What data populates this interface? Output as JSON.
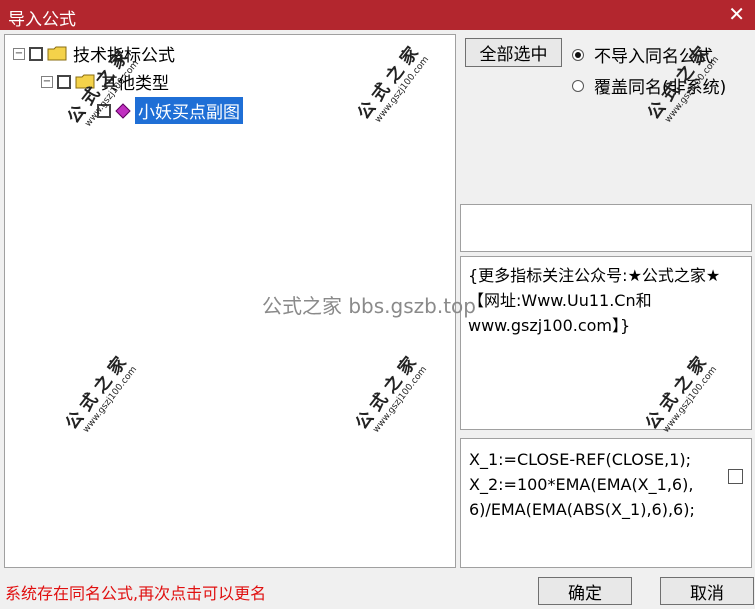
{
  "window": {
    "title": "导入公式",
    "close_glyph": "✕",
    "accent": "#b3262e"
  },
  "tree": {
    "root": {
      "toggle": "−",
      "label": "技术指标公式"
    },
    "group": {
      "toggle": "−",
      "label": "其他类型"
    },
    "item": {
      "label": "小妖买点副图",
      "selected": true
    }
  },
  "buttons": {
    "select_all": "全部选中",
    "ok": "确定",
    "cancel": "取消"
  },
  "import_options": [
    {
      "label": "不导入同名公式",
      "checked": true
    },
    {
      "label": "覆盖同名(非系统)",
      "checked": false
    }
  ],
  "description": "{更多指标关注公众号:★公式之家★ 【网址:Www.Uu11.Cn和www.gszj100.com】}",
  "code": "X_1:=CLOSE-REF(CLOSE,1);\nX_2:=100*EMA(EMA(X_1,6),6)/EMA(EMA(ABS(X_1),6),6);",
  "status_message": "系统存在同名公式,再次点击可以更名",
  "watermark": {
    "cn": "公式之家",
    "url": "www.gszj100.com",
    "center_text": "公式之家 bbs.gszb.top"
  }
}
